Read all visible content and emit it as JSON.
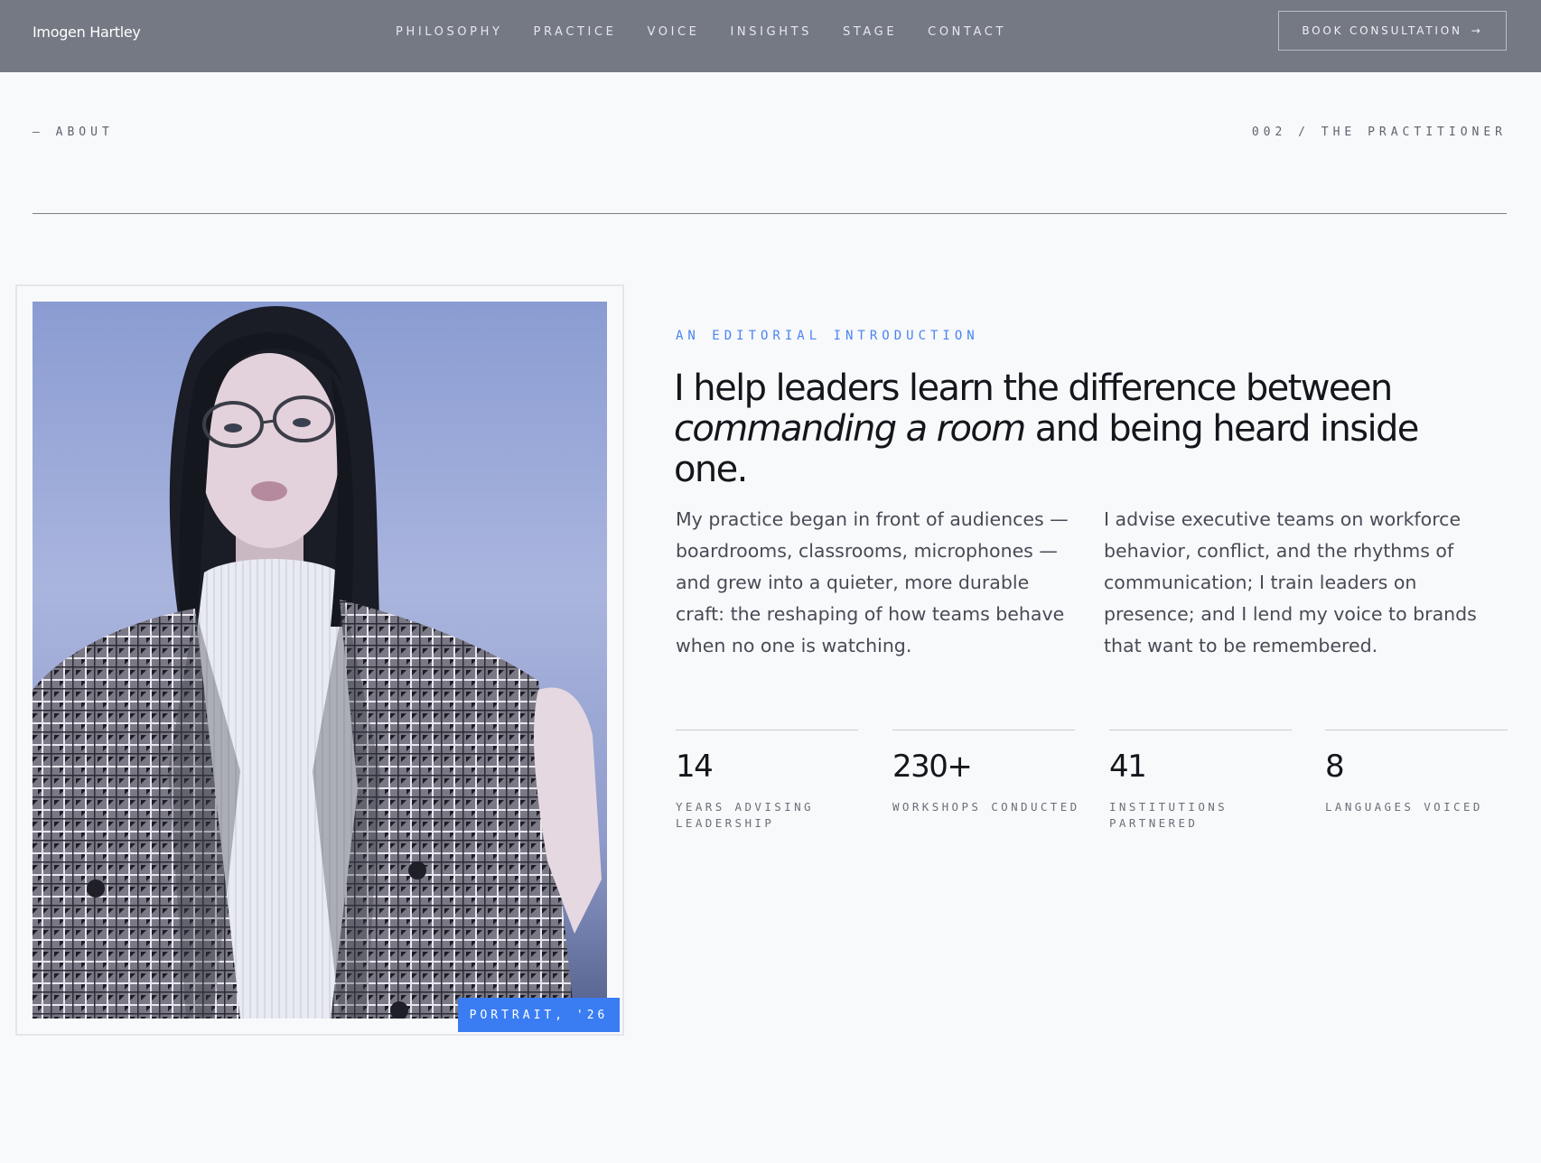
{
  "header": {
    "brand": "Imogen Hartley",
    "nav": [
      "PHILOSOPHY",
      "PRACTICE",
      "VOICE",
      "INSIGHTS",
      "STAGE",
      "CONTACT"
    ],
    "cta_label": "BOOK CONSULTATION",
    "cta_icon": "→"
  },
  "section": {
    "eyebrow_left": "— ABOUT",
    "eyebrow_right": "002 / THE PRACTITIONER"
  },
  "portrait": {
    "alt": "Portrait of Imogen Hartley",
    "tag": "PORTRAIT, '26"
  },
  "intro": {
    "kicker": "AN EDITORIAL INTRODUCTION",
    "headline_pre": "I help leaders learn the difference between ",
    "headline_em": "commanding a room",
    "headline_post": " and being heard inside one.",
    "body_left": "My practice began in front of audiences — boardrooms, classrooms, microphones — and grew into a quieter, more durable craft: the reshaping of how teams behave when no one is watching.",
    "body_right": "I advise executive teams on workforce behavior, conflict, and the rhythms of communication; I train leaders on presence; and I lend my voice to brands that want to be remembered."
  },
  "stats": [
    {
      "num": "14",
      "label": "YEARS ADVISING LEADERSHIP"
    },
    {
      "num": "230+",
      "label": "WORKSHOPS CONDUCTED"
    },
    {
      "num": "41",
      "label": "INSTITUTIONS PARTNERED"
    },
    {
      "num": "8",
      "label": "LANGUAGES VOICED"
    }
  ],
  "colors": {
    "nav_bg": "#757983",
    "accent": "#3a7df3",
    "page_bg": "#f8f9fb"
  }
}
